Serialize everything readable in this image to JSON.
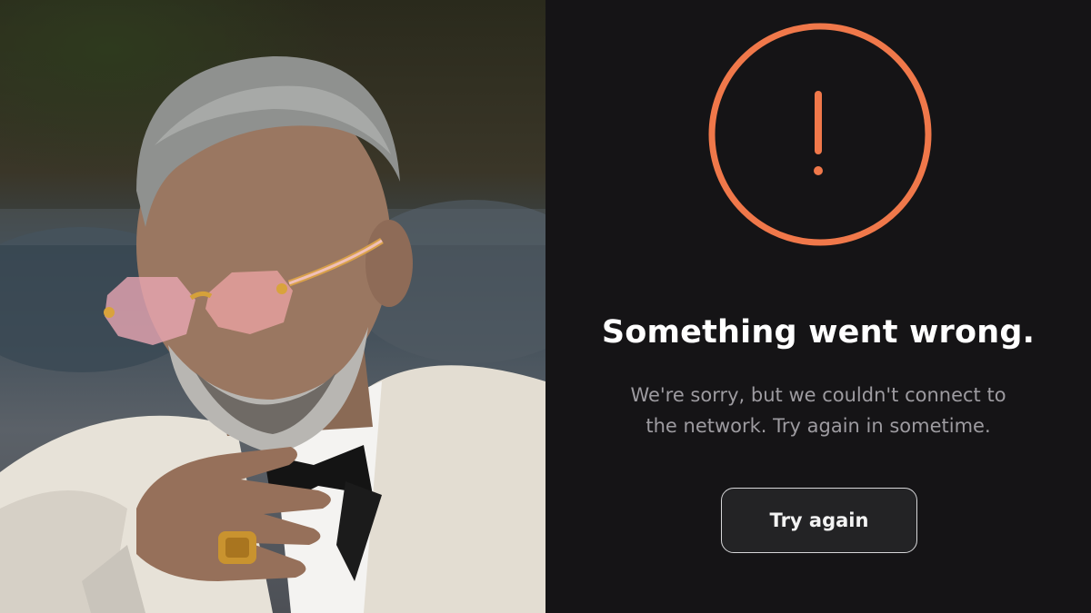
{
  "photo": {
    "alt_icon": "person-photo"
  },
  "error": {
    "icon": "alert-circle-icon",
    "title": "Something went wrong.",
    "message_line1": "We're sorry, but we couldn't connect to",
    "message_line2": "the network. Try again in sometime.",
    "retry_label": "Try again"
  },
  "colors": {
    "background": "#151416",
    "accent": "#f0784a",
    "title": "#ffffff",
    "message": "#9d9ba0",
    "button_border": "#d7d7d9"
  }
}
